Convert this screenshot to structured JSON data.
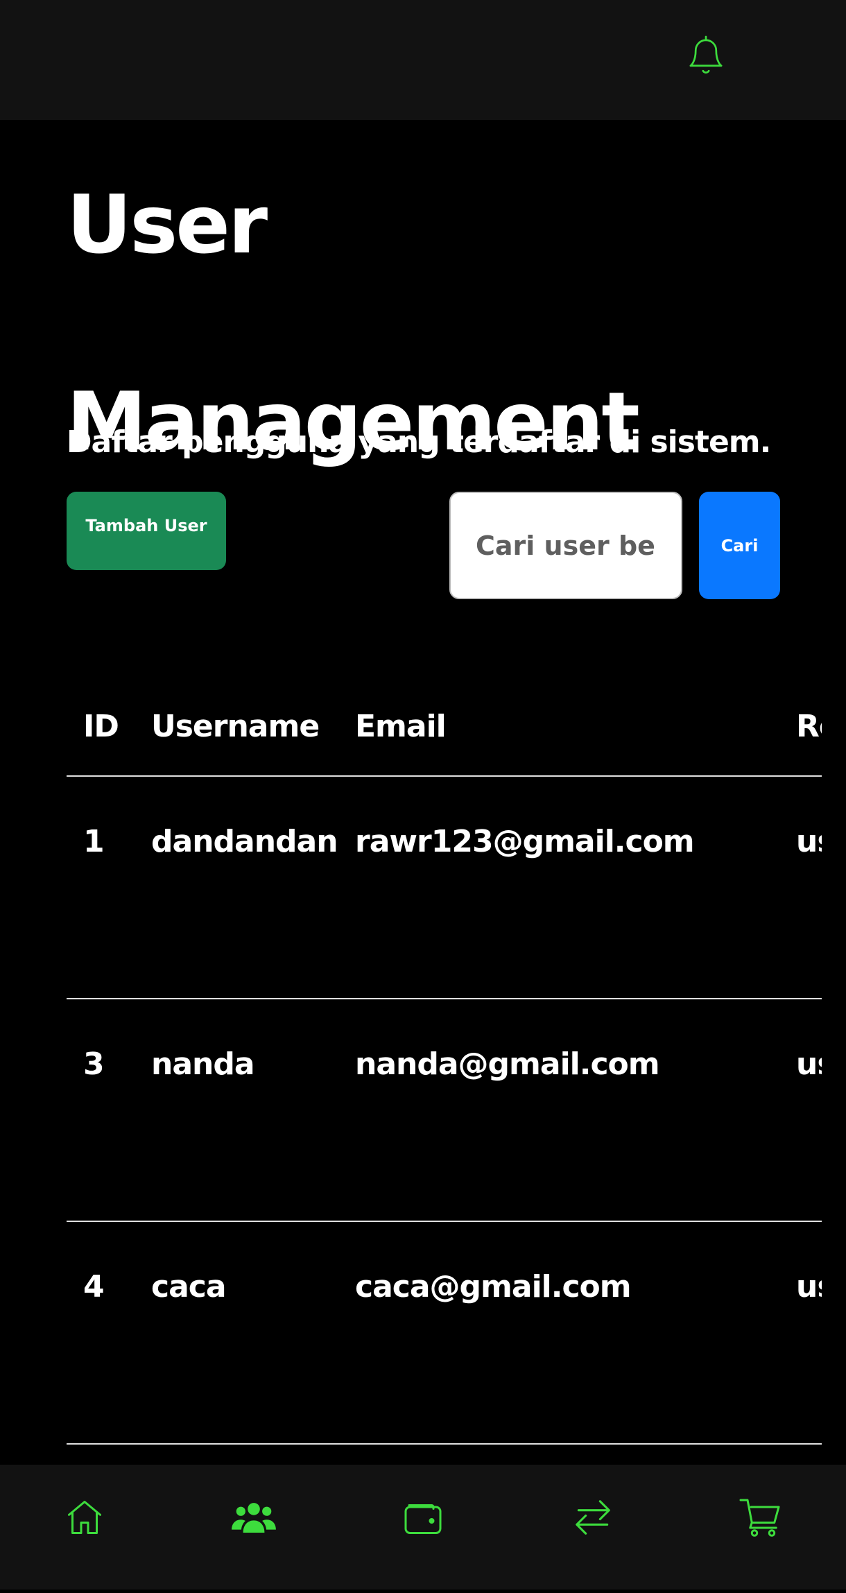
{
  "topbar": {
    "notification_icon": "bell-icon"
  },
  "page": {
    "title": "User Management",
    "subtitle": "Daftar pengguna yang terdaftar di sistem."
  },
  "actions": {
    "add_user_label": "Tambah User",
    "search_placeholder": "Cari user berdasarkan username atau email",
    "search_label": "Cari"
  },
  "table": {
    "headers": [
      "ID",
      "Username",
      "Email",
      "Role"
    ],
    "rows": [
      {
        "id": "1",
        "username": "dandandan",
        "email": "rawr123@gmail.com",
        "role": "user"
      },
      {
        "id": "3",
        "username": "nanda",
        "email": "nanda@gmail.com",
        "role": "user"
      },
      {
        "id": "4",
        "username": "caca",
        "email": "caca@gmail.com",
        "role": "user"
      }
    ]
  },
  "bottom_nav": {
    "items": [
      {
        "icon": "home-icon"
      },
      {
        "icon": "users-icon",
        "active": true
      },
      {
        "icon": "wallet-icon"
      },
      {
        "icon": "transfer-icon"
      },
      {
        "icon": "cart-icon"
      }
    ]
  },
  "colors": {
    "accent_green": "#3ddc3d",
    "add_button": "#1a8a55",
    "search_button": "#0a78ff",
    "bar_background": "#121212",
    "page_background": "#000000"
  }
}
